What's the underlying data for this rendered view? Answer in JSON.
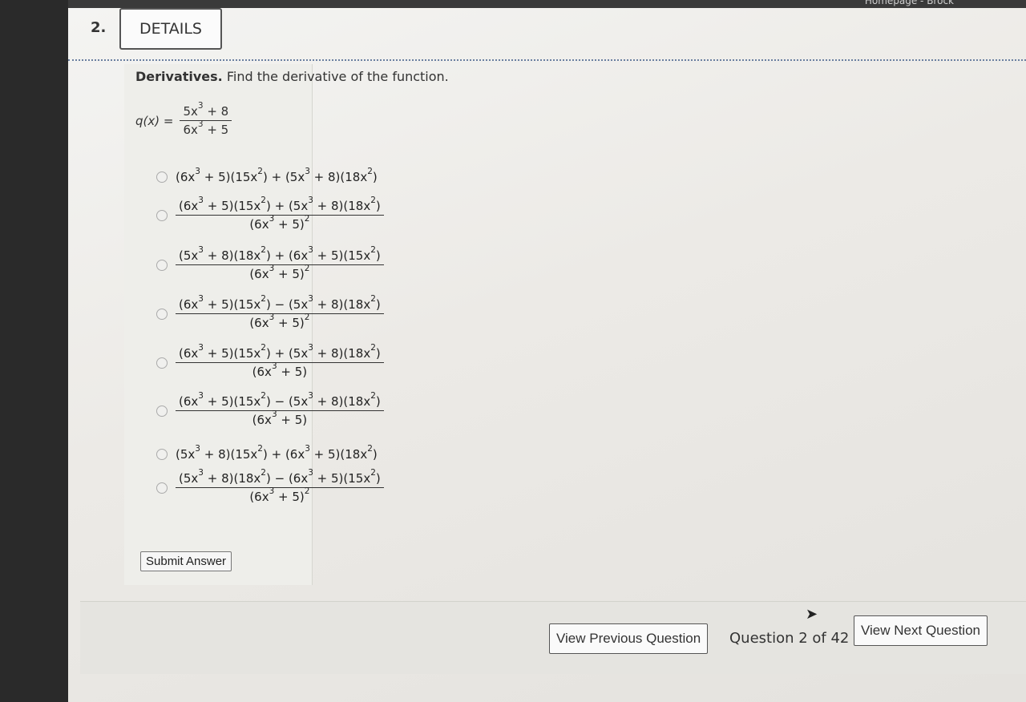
{
  "topbar": {
    "text": "Homepage - Brock"
  },
  "question": {
    "number": "2.",
    "details_label": "DETAILS"
  },
  "prompt": {
    "bold": "Derivatives.",
    "text": "Find the derivative of the function."
  },
  "function": {
    "lhs": "q(x) ="
  },
  "submit_label": "Submit Answer",
  "nav": {
    "prev_label": "View Previous Question",
    "counter": "Question 2 of 42",
    "next_label": "View Next Question"
  }
}
